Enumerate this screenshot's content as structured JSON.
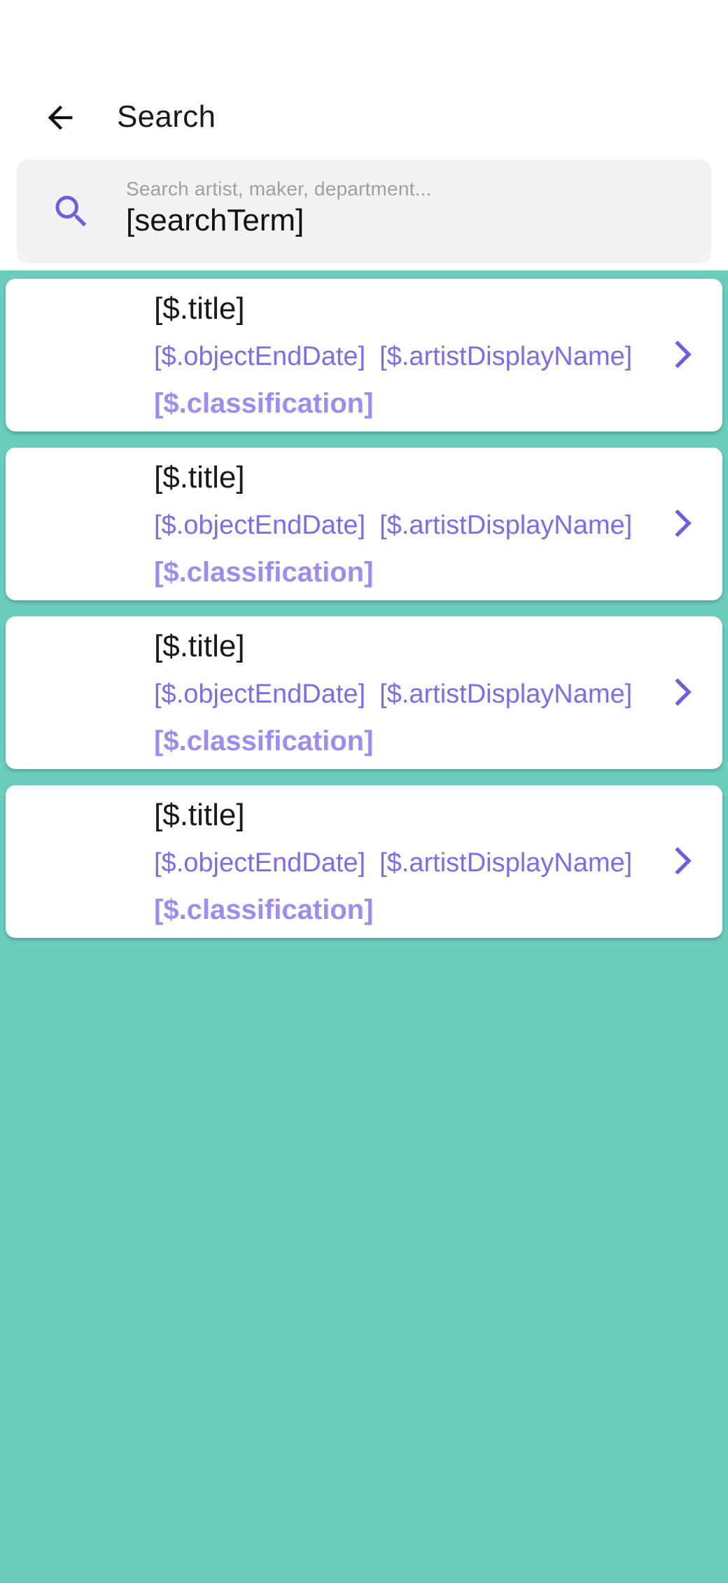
{
  "header": {
    "title": "Search"
  },
  "search": {
    "placeholder": "Search artist, maker, department...",
    "value": "[searchTerm]"
  },
  "colors": {
    "background": "#6bcebc",
    "accent": "#6c5ce7",
    "meta_text": "#7b6cf0",
    "classification_text": "#9b8df2"
  },
  "icons": {
    "back": "arrow-left-icon",
    "search": "search-icon",
    "item": "chevron-right-icon"
  },
  "results": [
    {
      "title": "[$.title]",
      "end_date": "[$.objectEndDate]",
      "artist": "[$.artistDisplayName]",
      "classification": "[$.classification]"
    },
    {
      "title": "[$.title]",
      "end_date": "[$.objectEndDate]",
      "artist": "[$.artistDisplayName]",
      "classification": "[$.classification]"
    },
    {
      "title": "[$.title]",
      "end_date": "[$.objectEndDate]",
      "artist": "[$.artistDisplayName]",
      "classification": "[$.classification]"
    },
    {
      "title": "[$.title]",
      "end_date": "[$.objectEndDate]",
      "artist": "[$.artistDisplayName]",
      "classification": "[$.classification]"
    }
  ]
}
